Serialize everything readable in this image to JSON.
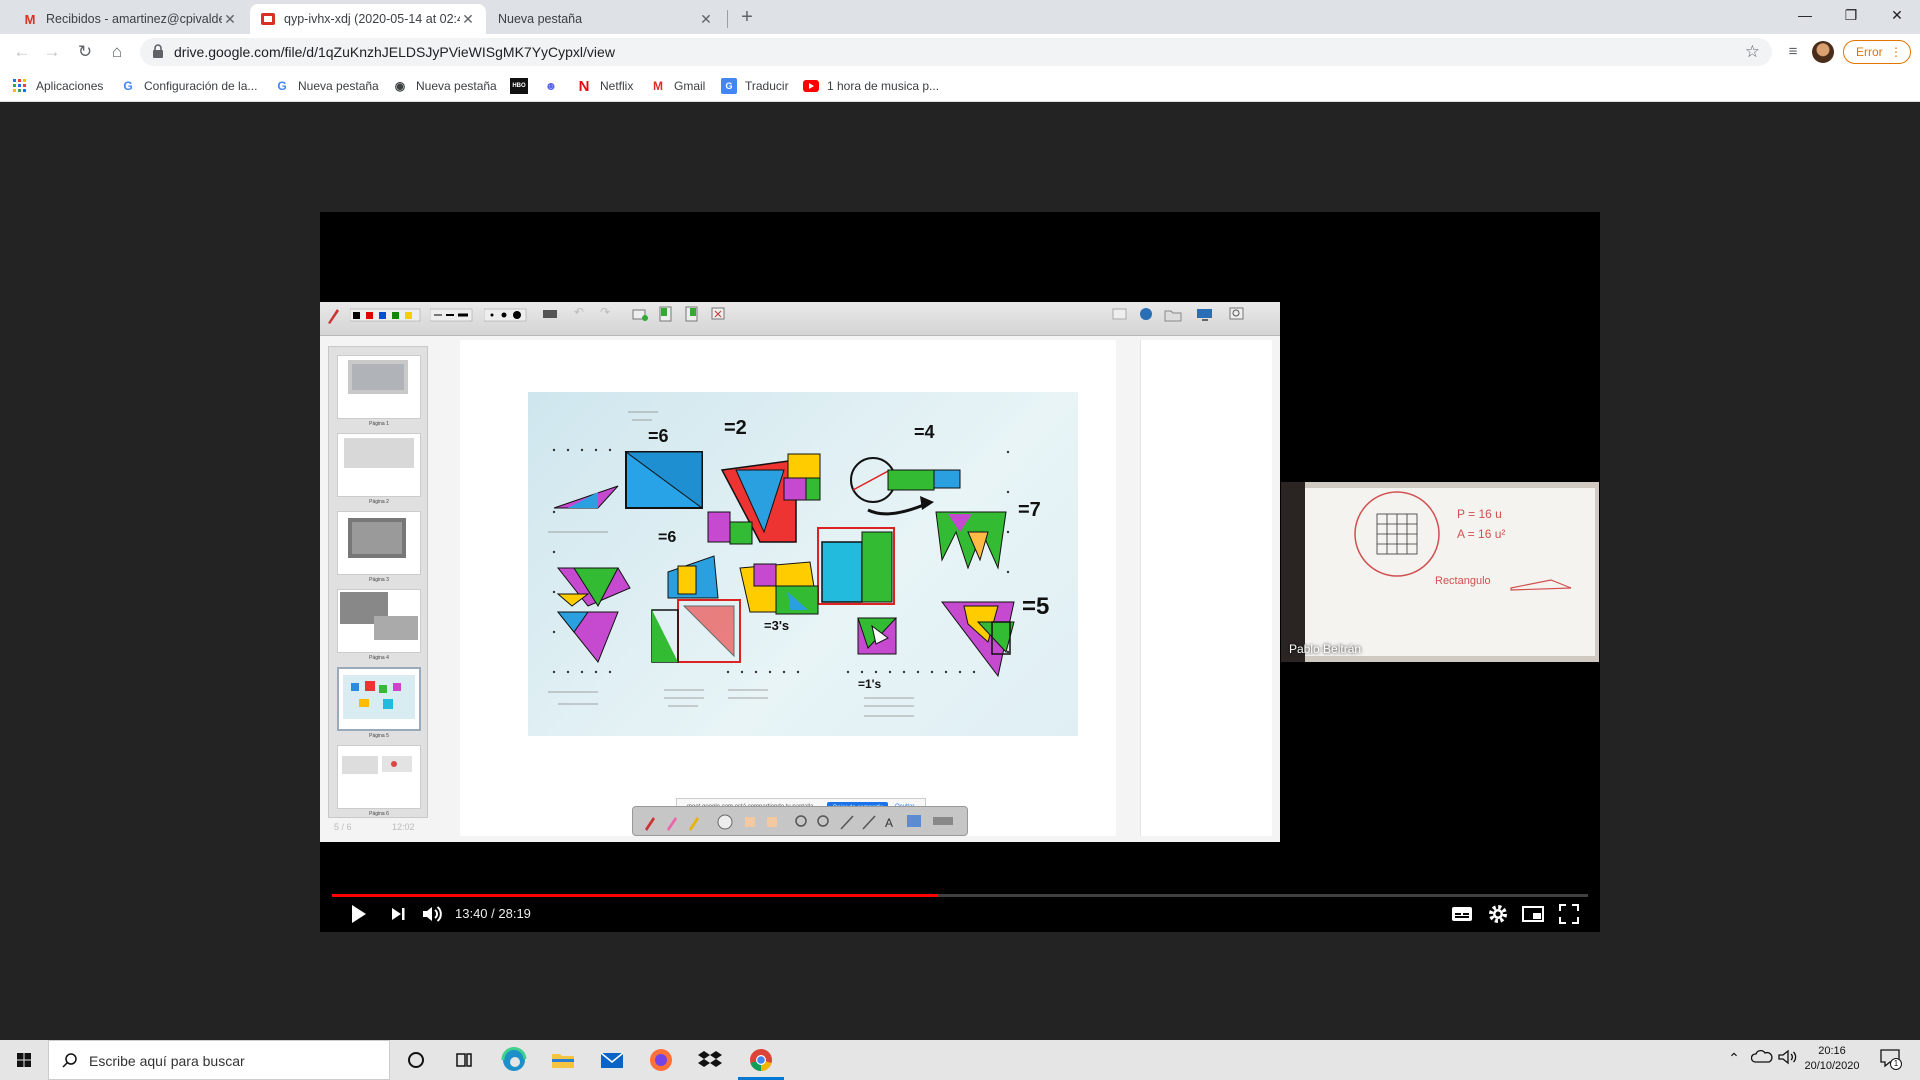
{
  "tabs": [
    {
      "title": "Recibidos - amartinez@cpivalde",
      "icon": "gmail-icon",
      "close": "✕"
    },
    {
      "title": "qyp-ivhx-xdj (2020-05-14 at 02:4",
      "icon": "drive-video-icon",
      "close": "✕"
    },
    {
      "title": "Nueva pestaña",
      "icon": "",
      "close": "✕"
    }
  ],
  "new_tab": "+",
  "window": {
    "minimize": "—",
    "maximize": "❐",
    "close": "✕"
  },
  "address": {
    "url": "drive.google.com/file/d/1qZuKnzhJELDSJyPVieWISgMK7YyCypxl/view"
  },
  "profile": {
    "error_label": "Error"
  },
  "bookmarks": [
    {
      "label": "Aplicaciones",
      "icon": "apps-grid-icon"
    },
    {
      "label": "Configuración de la...",
      "icon": "google-icon"
    },
    {
      "label": "Nueva pestaña",
      "icon": "google-icon"
    },
    {
      "label": "Nueva pestaña",
      "icon": "globe-icon"
    },
    {
      "label": "",
      "icon": "hbo-icon"
    },
    {
      "label": "",
      "icon": "discord-icon"
    },
    {
      "label": "Netflix",
      "icon": "netflix-icon"
    },
    {
      "label": "Gmail",
      "icon": "gmail-icon"
    },
    {
      "label": "Traducir",
      "icon": "translate-icon"
    },
    {
      "label": "1 hora de musica p...",
      "icon": "youtube-icon"
    }
  ],
  "whiteboard": {
    "page_indicator": "5 / 6",
    "clock": "12:02",
    "thumb_labels": [
      "Página 1",
      "Página 2",
      "Página 3",
      "Página 4",
      "Página 5",
      "Página 6"
    ],
    "drawing_texts": {
      "eq1": "=6",
      "eq2": "=2",
      "eq3": "=4",
      "eq4": "=7",
      "eq5": "=5",
      "eq6": "=6",
      "eq7": "=1's",
      "eq8": "=3's"
    }
  },
  "share_bar": {
    "text": "meet.google.com está compartiendo tu pantalla.",
    "stop_button": "Dejar de compartir",
    "hide_button": "Ocultar"
  },
  "camera": {
    "participant_name": "Pablo Beltrán",
    "note_p": "P = 16 u",
    "note_a": "A = 16 u²",
    "note_word": "Rectangulo"
  },
  "player": {
    "time": "13:40 / 28:19",
    "progress": 0.4826
  },
  "taskbar": {
    "search_placeholder": "Escribe aquí para buscar",
    "time": "20:16",
    "date": "20/10/2020",
    "notification_count": "1"
  }
}
